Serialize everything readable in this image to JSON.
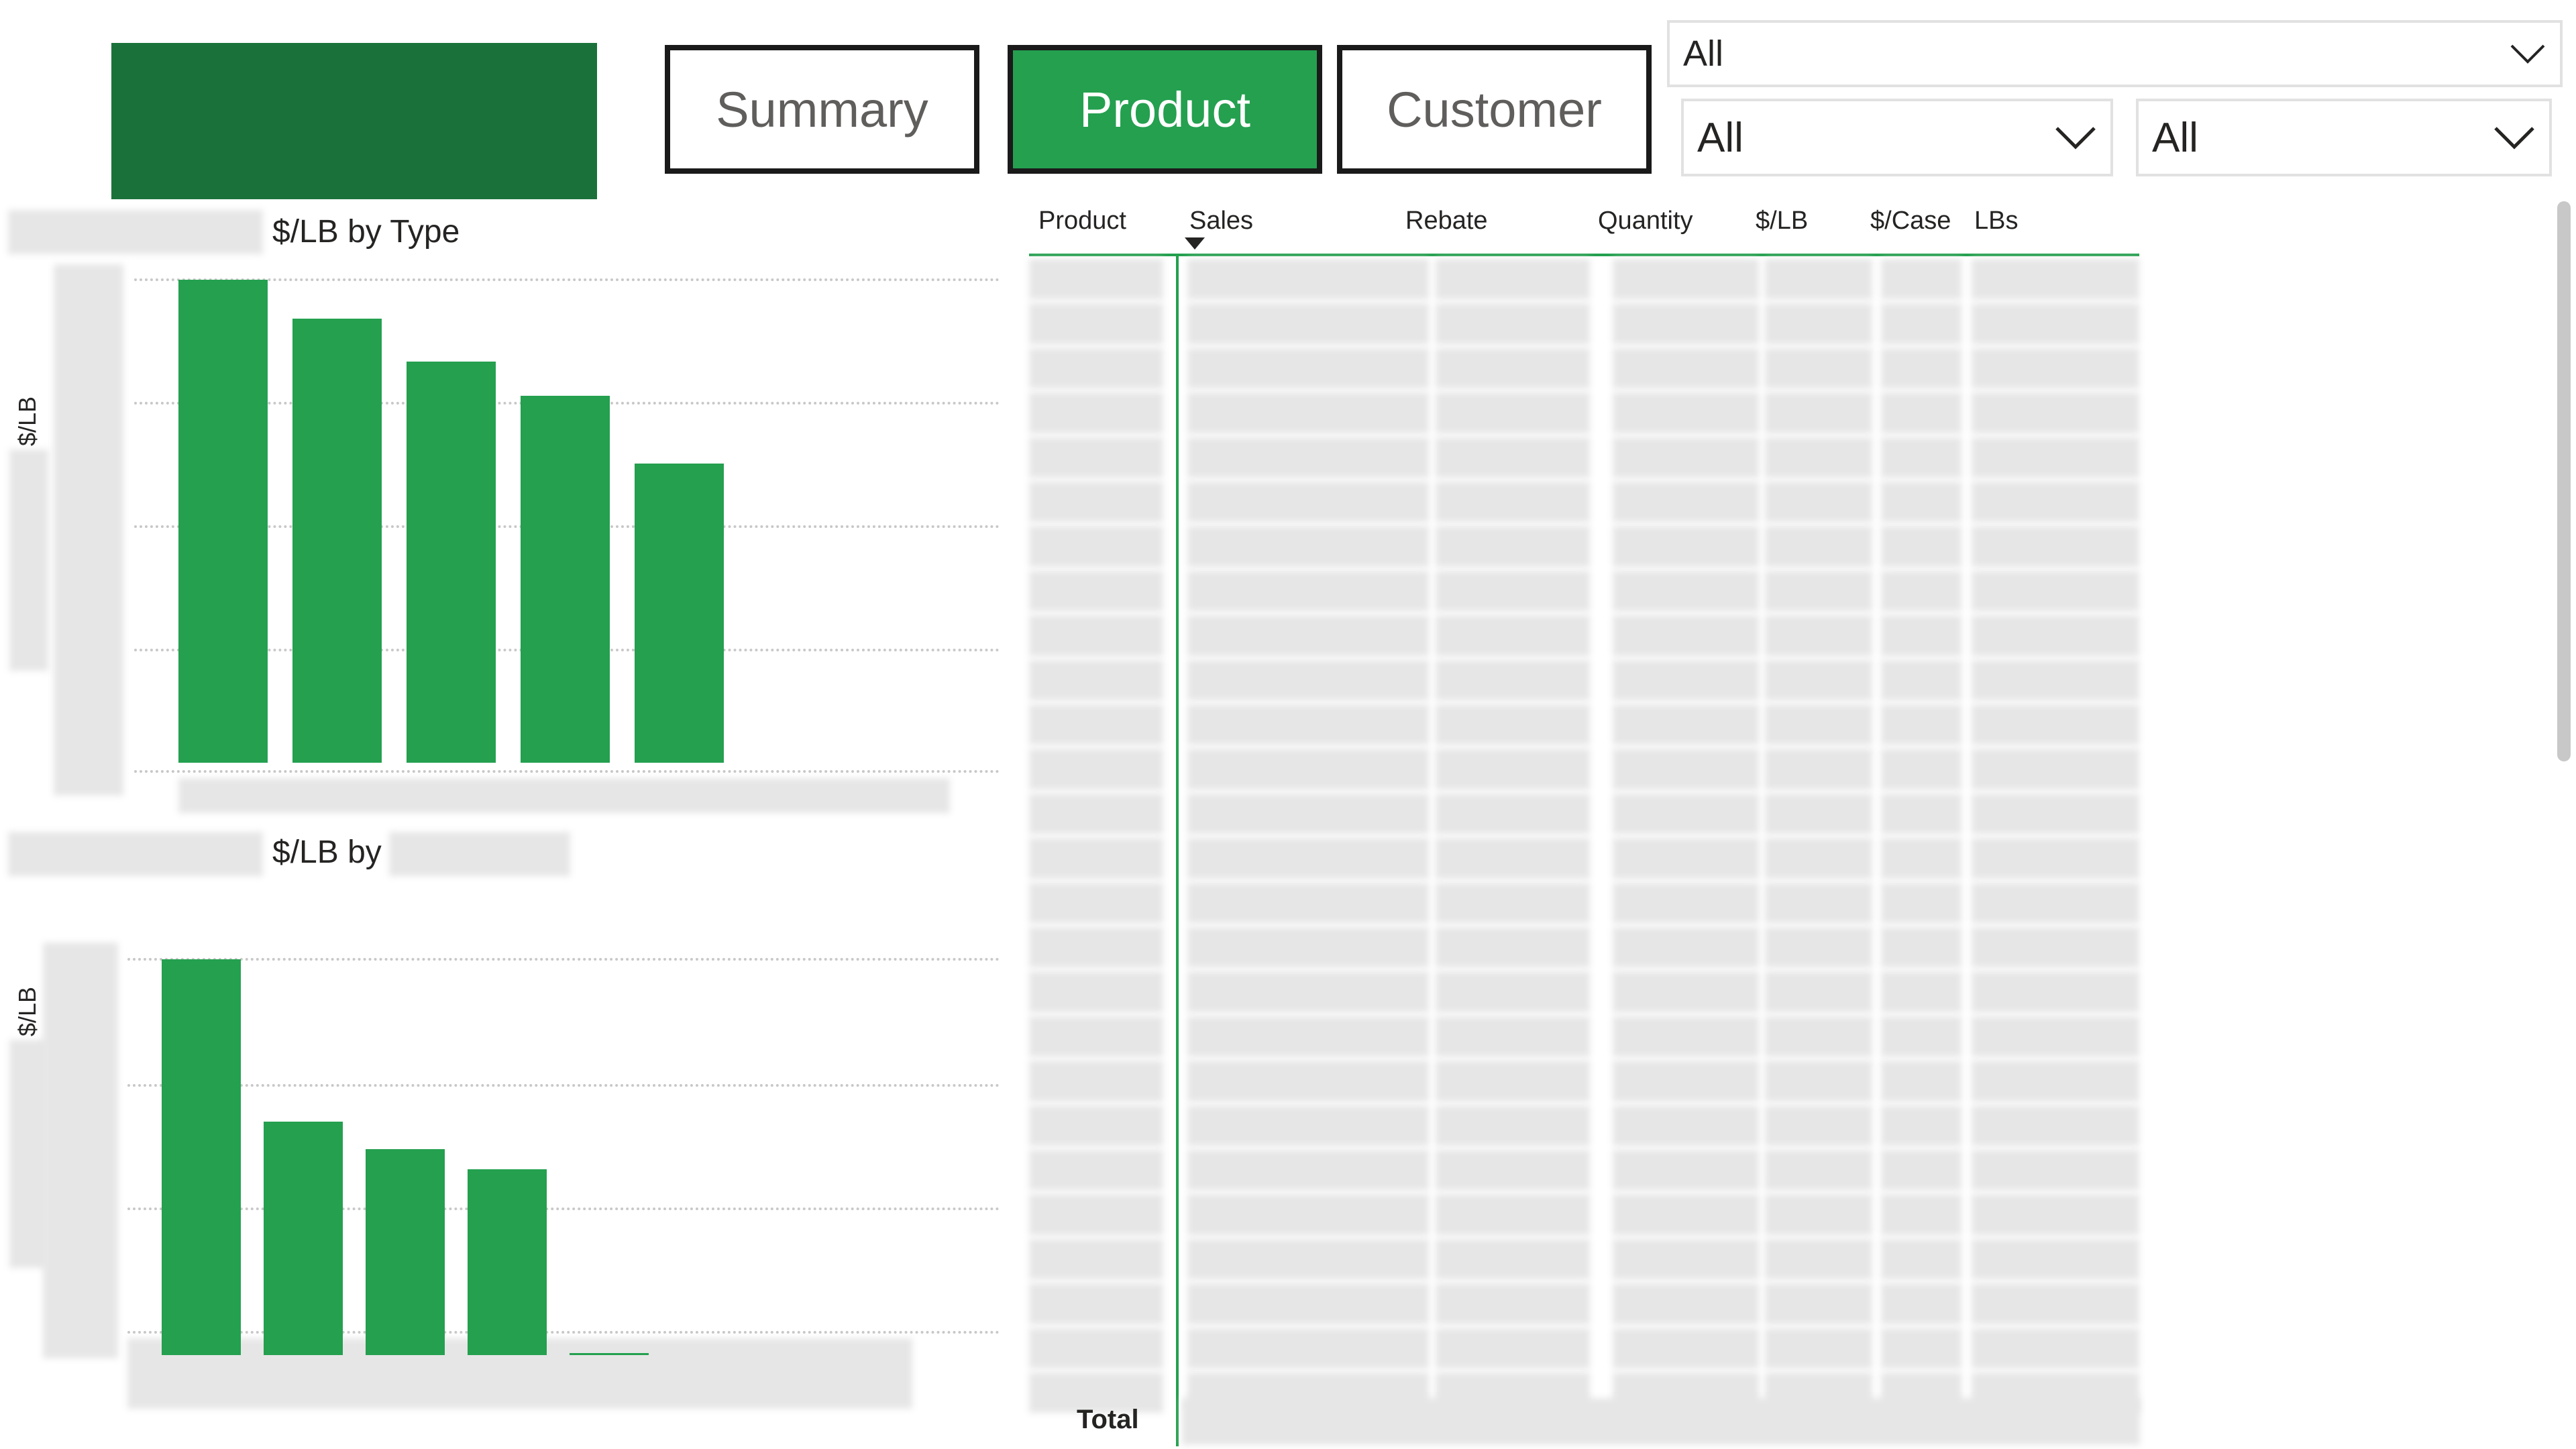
{
  "nav": {
    "summary": "Summary",
    "product": "Product",
    "customer": "Customer",
    "active": "product"
  },
  "filters": {
    "top": "All",
    "left": "All",
    "right": "All"
  },
  "chart1_title": "$/LB by Type",
  "chart2_title": "$/LB by",
  "table": {
    "headers": [
      "Product",
      "Sales",
      "Rebate",
      "Quantity",
      "$/LB",
      "$/Case",
      "LBs"
    ],
    "total_label": "Total"
  },
  "colors": {
    "accent": "#24a04f",
    "logo": "#1a723a"
  },
  "chart_data": [
    {
      "type": "bar",
      "title": "$/LB by Type",
      "ylabel": "$/LB",
      "grid": true,
      "series": [
        {
          "values": [
            1.0,
            0.92,
            0.83,
            0.76,
            0.62
          ]
        }
      ]
    },
    {
      "type": "bar",
      "title": "$/LB by",
      "ylabel": "$/LB",
      "grid": true,
      "series": [
        {
          "values": [
            1.0,
            0.59,
            0.52,
            0.47,
            0.0
          ]
        }
      ]
    }
  ]
}
